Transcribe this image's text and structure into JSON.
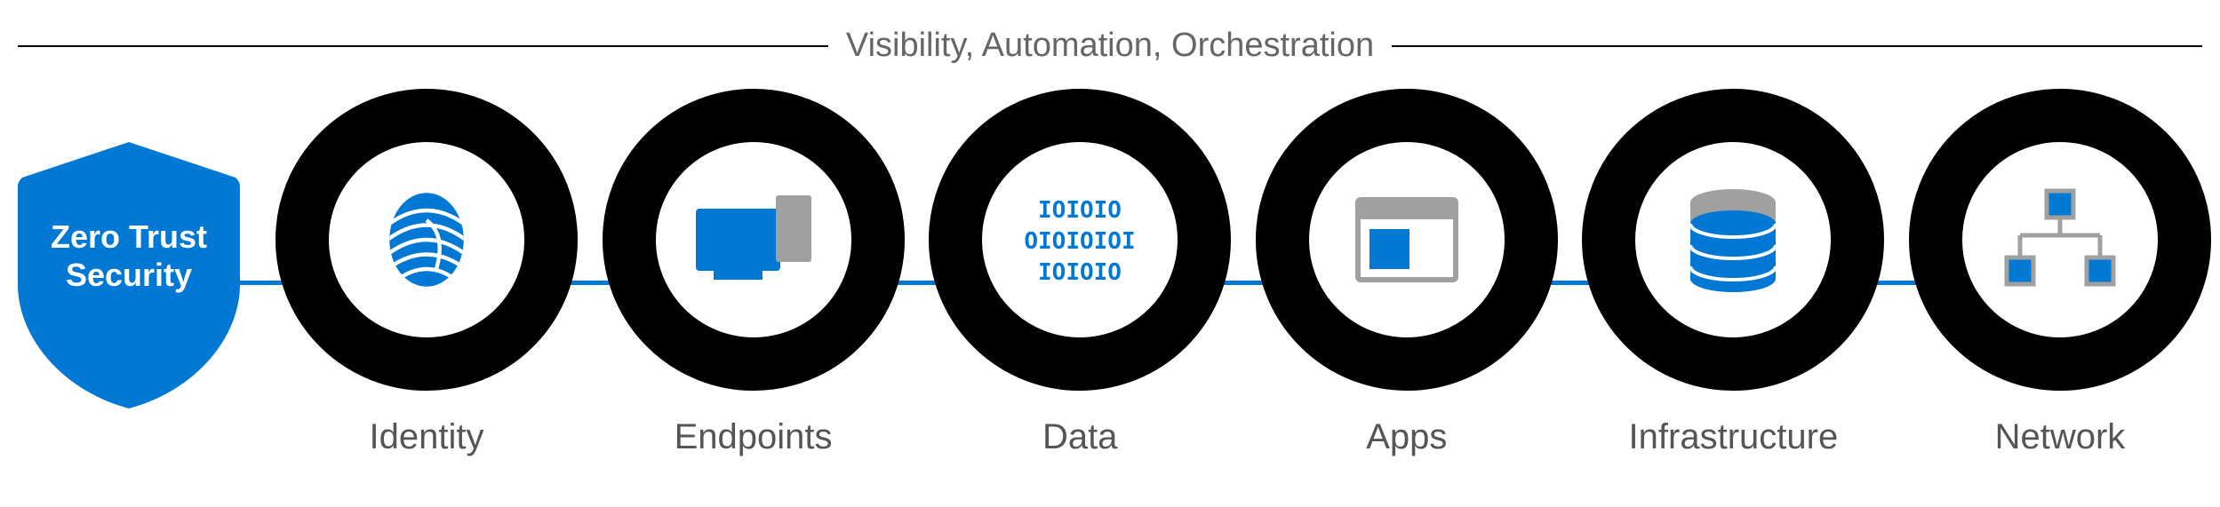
{
  "header": {
    "title": "Visibility, Automation, Orchestration"
  },
  "shield": {
    "title_line1": "Zero Trust",
    "title_line2": "Security"
  },
  "pillars": [
    {
      "id": "identity",
      "label": "Identity",
      "icon": "fingerprint-icon"
    },
    {
      "id": "endpoints",
      "label": "Endpoints",
      "icon": "devices-icon"
    },
    {
      "id": "data",
      "label": "Data",
      "icon": "binary-icon"
    },
    {
      "id": "apps",
      "label": "Apps",
      "icon": "window-icon"
    },
    {
      "id": "infrastructure",
      "label": "Infrastructure",
      "icon": "database-icon"
    },
    {
      "id": "network",
      "label": "Network",
      "icon": "network-icon"
    }
  ],
  "colors": {
    "accent": "#0078d4",
    "ring": "#000000",
    "text_muted": "#666666",
    "gray_icon": "#a0a0a0"
  }
}
